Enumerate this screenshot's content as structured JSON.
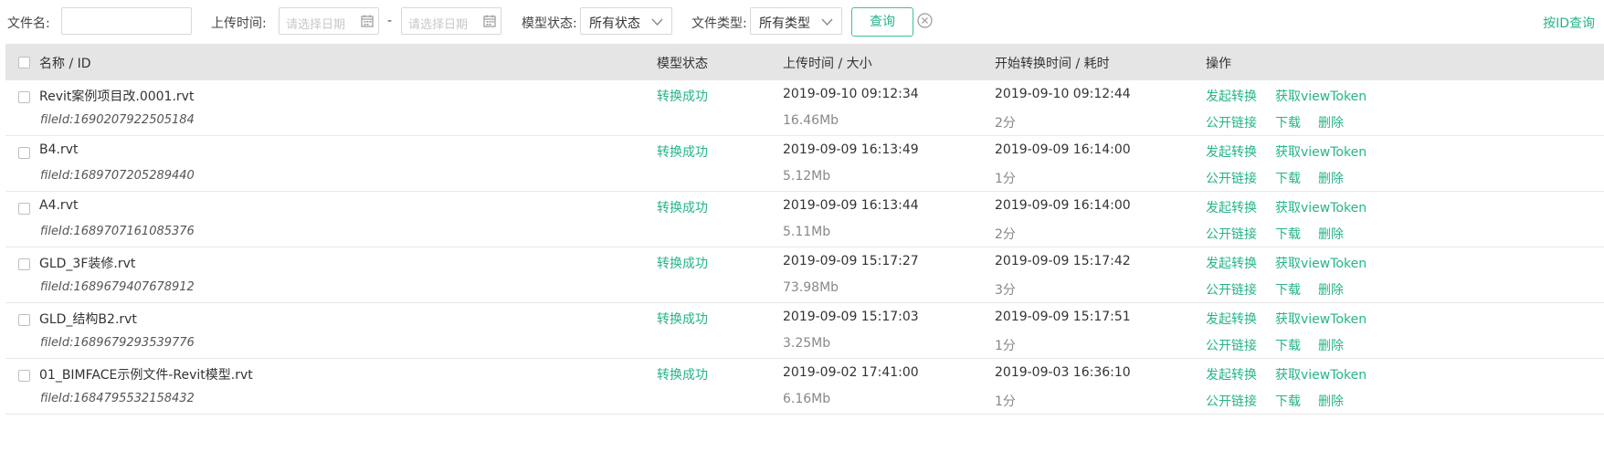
{
  "filter": {
    "filename_label": "文件名:",
    "filename_value": "",
    "upload_time_label": "上传时间:",
    "date_start_placeholder": "请选择日期",
    "date_separator": "-",
    "date_end_placeholder": "请选择日期",
    "model_status_label": "模型状态:",
    "model_status_value": "所有状态",
    "file_type_label": "文件类型:",
    "file_type_value": "所有类型",
    "query_button": "查询",
    "id_query_link": "按ID查询"
  },
  "table": {
    "headers": {
      "name_id": "名称 / ID",
      "model_status": "模型状态",
      "upload_time_size": "上传时间 / 大小",
      "convert_time_duration": "开始转换时间 / 耗时",
      "actions": "操作"
    },
    "fileid_label": "fileId:",
    "action_labels": {
      "start_convert": "发起转换",
      "get_token": "获取viewToken",
      "public_link": "公开链接",
      "download": "下载",
      "delete": "删除"
    },
    "rows": [
      {
        "name": "Revit案例项目改.0001.rvt",
        "fileid": "1690207922505184",
        "status": "转换成功",
        "upload_time": "2019-09-10 09:12:34",
        "size": "16.46Mb",
        "convert_time": "2019-09-10 09:12:44",
        "duration": "2分"
      },
      {
        "name": "B4.rvt",
        "fileid": "1689707205289440",
        "status": "转换成功",
        "upload_time": "2019-09-09 16:13:49",
        "size": "5.12Mb",
        "convert_time": "2019-09-09 16:14:00",
        "duration": "1分"
      },
      {
        "name": "A4.rvt",
        "fileid": "1689707161085376",
        "status": "转换成功",
        "upload_time": "2019-09-09 16:13:44",
        "size": "5.11Mb",
        "convert_time": "2019-09-09 16:14:00",
        "duration": "2分"
      },
      {
        "name": "GLD_3F装修.rvt",
        "fileid": "1689679407678912",
        "status": "转换成功",
        "upload_time": "2019-09-09 15:17:27",
        "size": "73.98Mb",
        "convert_time": "2019-09-09 15:17:42",
        "duration": "3分"
      },
      {
        "name": "GLD_结构B2.rvt",
        "fileid": "1689679293539776",
        "status": "转换成功",
        "upload_time": "2019-09-09 15:17:03",
        "size": "3.25Mb",
        "convert_time": "2019-09-09 15:17:51",
        "duration": "1分"
      },
      {
        "name": "01_BIMFACE示例文件-Revit模型.rvt",
        "fileid": "1684795532158432",
        "status": "转换成功",
        "upload_time": "2019-09-02 17:41:00",
        "size": "6.16Mb",
        "convert_time": "2019-09-03 16:36:10",
        "duration": "1分"
      }
    ]
  },
  "colors": {
    "accent": "#27b38b",
    "header_bg": "#e5e5e5"
  }
}
